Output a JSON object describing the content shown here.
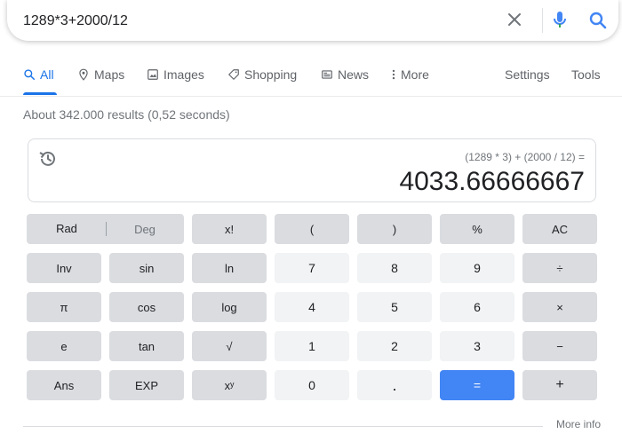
{
  "search": {
    "query": "1289*3+2000/12"
  },
  "tabs": {
    "all": "All",
    "maps": "Maps",
    "images": "Images",
    "shopping": "Shopping",
    "news": "News",
    "more": "More",
    "settings": "Settings",
    "tools": "Tools"
  },
  "stats": "About 342.000 results (0,52 seconds)",
  "calc": {
    "expression": "(1289 * 3) + (2000 / 12) =",
    "result": "4033.66666667",
    "rad": "Rad",
    "deg": "Deg",
    "keys": {
      "fact": "x!",
      "lparen": "(",
      "rparen": ")",
      "percent": "%",
      "ac": "AC",
      "inv": "Inv",
      "sin": "sin",
      "ln": "ln",
      "d7": "7",
      "d8": "8",
      "d9": "9",
      "div": "÷",
      "pi": "π",
      "cos": "cos",
      "log": "log",
      "d4": "4",
      "d5": "5",
      "d6": "6",
      "mul": "×",
      "e": "e",
      "tan": "tan",
      "sqrt": "√",
      "d1": "1",
      "d2": "2",
      "d3": "3",
      "sub": "−",
      "ans": "Ans",
      "exp": "EXP",
      "pow": "xʸ",
      "d0": "0",
      "dot": ".",
      "eq": "=",
      "add": "+"
    }
  },
  "more_info": "More info",
  "colors": {
    "accent": "#1a73e8",
    "equals_key": "#4285f4",
    "function_key": "#dadce0",
    "number_key": "#f1f3f4"
  },
  "icons": [
    "clear-icon",
    "mic-icon",
    "search-icon",
    "history-icon",
    "maps-pin-icon",
    "images-icon",
    "shopping-tag-icon",
    "news-icon",
    "more-dots-icon"
  ]
}
